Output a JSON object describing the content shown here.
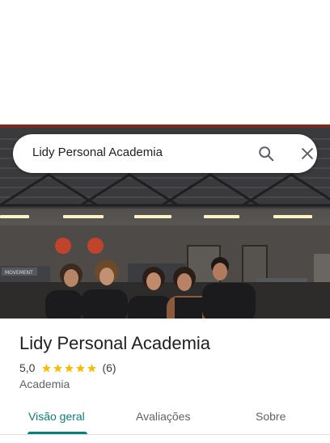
{
  "search": {
    "query": "Lidy Personal Academia"
  },
  "place": {
    "title": "Lidy Personal Academia",
    "rating": "5,0",
    "stars": 5,
    "review_count": "(6)",
    "category": "Academia"
  },
  "tabs": [
    {
      "label": "Visão geral",
      "active": true
    },
    {
      "label": "Avaliações",
      "active": false
    },
    {
      "label": "Sobre",
      "active": false
    }
  ],
  "colors": {
    "accent": "#0b7f79",
    "star": "#fbbc04"
  },
  "photo": {
    "equipment_label": "MOVEMENT"
  }
}
